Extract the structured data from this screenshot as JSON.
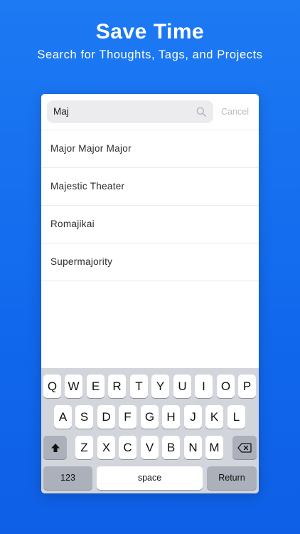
{
  "header": {
    "title": "Save Time",
    "subtitle": "Search for Thoughts, Tags, and Projects"
  },
  "search": {
    "value": "Maj",
    "cancel_label": "Cancel"
  },
  "results": [
    "Major Major Major",
    "Majestic Theater",
    "Romajikai",
    "Supermajority"
  ],
  "keyboard": {
    "row1": [
      "Q",
      "W",
      "E",
      "R",
      "T",
      "Y",
      "U",
      "I",
      "O",
      "P"
    ],
    "row2": [
      "A",
      "S",
      "D",
      "F",
      "G",
      "H",
      "J",
      "K",
      "L"
    ],
    "row3": [
      "Z",
      "X",
      "C",
      "V",
      "B",
      "N",
      "M"
    ],
    "numbers_label": "123",
    "space_label": "space",
    "return_label": "Return",
    "shift_icon": "shift-arrow-up",
    "delete_icon": "backspace"
  },
  "colors": {
    "background": "#1168ec",
    "keyboard_bg": "#d2d5db",
    "cancel_text": "#b9bcc4"
  }
}
